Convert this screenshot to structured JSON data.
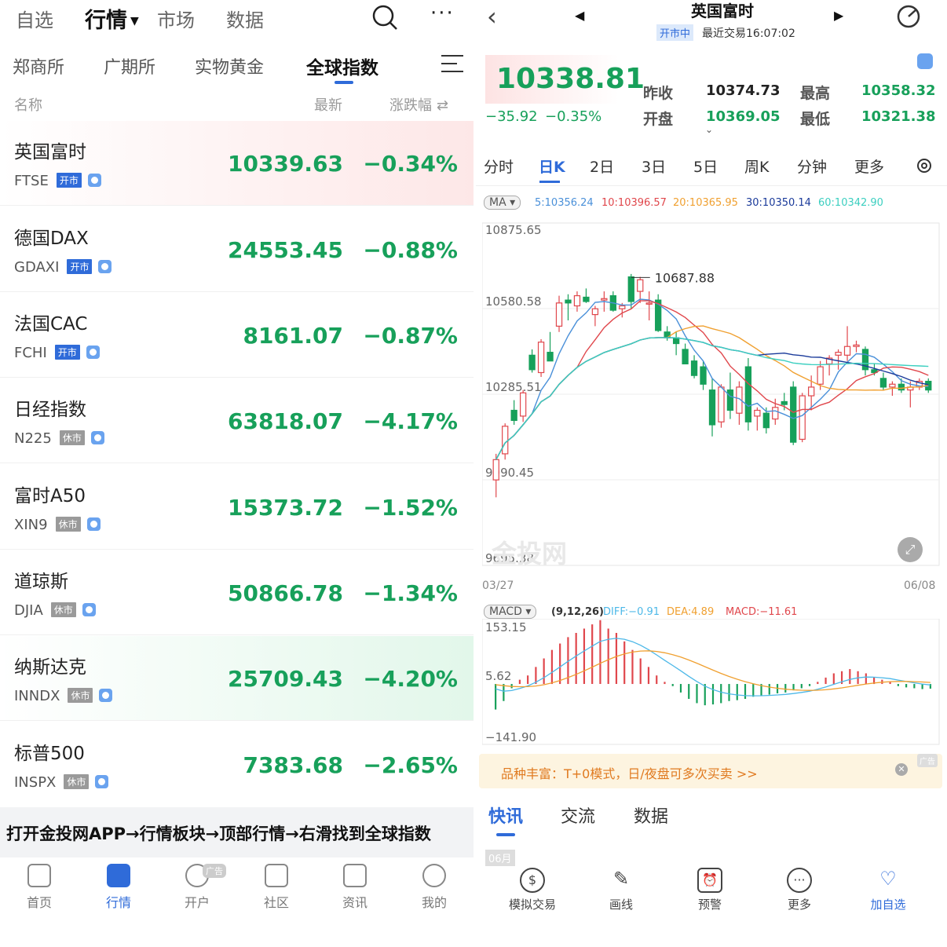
{
  "left": {
    "top_tabs": [
      "自选",
      "行情",
      "市场",
      "数据"
    ],
    "active_top_tab": "行情",
    "sub_tabs": [
      "郑商所",
      "广期所",
      "实物黄金",
      "全球指数"
    ],
    "active_sub_tab": "全球指数",
    "col_headers": {
      "name": "名称",
      "latest": "最新",
      "change": "涨跌幅"
    },
    "rows": [
      {
        "name": "英国富时",
        "code": "FTSE",
        "status": "开市",
        "price": "10339.63",
        "pct": "−0.34%",
        "highlight": "red"
      },
      {
        "name": "德国DAX",
        "code": "GDAXI",
        "status": "开市",
        "price": "24553.45",
        "pct": "−0.88%",
        "highlight": ""
      },
      {
        "name": "法国CAC",
        "code": "FCHI",
        "status": "开市",
        "price": "8161.07",
        "pct": "−0.87%",
        "highlight": ""
      },
      {
        "name": "日经指数",
        "code": "N225",
        "status": "休市",
        "price": "63818.07",
        "pct": "−4.17%",
        "highlight": ""
      },
      {
        "name": "富时A50",
        "code": "XIN9",
        "status": "休市",
        "price": "15373.72",
        "pct": "−1.52%",
        "highlight": ""
      },
      {
        "name": "道琼斯",
        "code": "DJIA",
        "status": "休市",
        "price": "50866.78",
        "pct": "−1.34%",
        "highlight": ""
      },
      {
        "name": "纳斯达克",
        "code": "INNDX",
        "status": "休市",
        "price": "25709.43",
        "pct": "−4.20%",
        "highlight": "green"
      },
      {
        "name": "标普500",
        "code": "INSPX",
        "status": "休市",
        "price": "7383.68",
        "pct": "−2.65%",
        "highlight": ""
      }
    ],
    "instruction": "打开金投网APP→行情板块→顶部行情→右滑找到全球指数",
    "bottom_nav": [
      "首页",
      "行情",
      "开户",
      "社区",
      "资讯",
      "我的"
    ],
    "active_nav": "行情",
    "ad_badge": "广告"
  },
  "right": {
    "title": "英国富时",
    "status_badge": "开市中",
    "last_trade": "最近交易16:07:02",
    "price": "10338.81",
    "change": "−35.92",
    "change_pct": "−0.35%",
    "stats": {
      "prev_close_label": "昨收",
      "prev_close": "10374.73",
      "open_label": "开盘",
      "open": "10369.05",
      "high_label": "最高",
      "high": "10358.32",
      "low_label": "最低",
      "low": "10321.38"
    },
    "periods": [
      "分时",
      "日K",
      "2日",
      "3日",
      "5日",
      "周K",
      "分钟",
      "更多"
    ],
    "active_period": "日K",
    "ma_label": "MA",
    "ma_values": [
      {
        "text": "5:10356.24",
        "color": "#4a90d9"
      },
      {
        "text": "10:10396.57",
        "color": "#e0474c"
      },
      {
        "text": "20:10365.95",
        "color": "#f0a030"
      },
      {
        "text": "30:10350.14",
        "color": "#1a3a9a"
      },
      {
        "text": "60:10342.90",
        "color": "#3ccfc0"
      }
    ],
    "price_axis": [
      "10875.65",
      "10580.58",
      "10285.51",
      "9990.45",
      "9695.38"
    ],
    "max_label": "10687.88",
    "date_start": "03/27",
    "date_end": "06/08",
    "watermark": "金投网",
    "macd_label": "MACD",
    "macd_params": "(9,12,26)",
    "macd_values": [
      {
        "text": "DIFF:−0.91",
        "color": "#4cb8e8"
      },
      {
        "text": "DEA:4.89",
        "color": "#f0a030"
      },
      {
        "text": "MACD:−11.61",
        "color": "#e0474c"
      }
    ],
    "macd_axis": [
      "153.15",
      "5.62",
      "−141.90"
    ],
    "banner_text": "品种丰富：T+0模式，日/夜盘可多次买卖 >>",
    "banner_ad": "广告",
    "news_tabs": [
      "快讯",
      "交流",
      "数据"
    ],
    "active_news_tab": "快讯",
    "month_label": "06月",
    "tools": [
      "模拟交易",
      "画线",
      "预警",
      "更多",
      "加自选"
    ]
  },
  "chart_data": [
    {
      "type": "candlestick",
      "title": "英国富时 日K",
      "x_range": [
        "03/27",
        "06/08"
      ],
      "ylim": [
        9695.38,
        10875.65
      ],
      "y_ticks": [
        10875.65,
        10580.58,
        10285.51,
        9990.45,
        9695.38
      ],
      "max_marker": 10687.88,
      "candles": [
        {
          "o": 9990,
          "h": 10080,
          "l": 9930,
          "c": 10060
        },
        {
          "o": 10080,
          "h": 10185,
          "l": 10060,
          "c": 10175
        },
        {
          "o": 10230,
          "h": 10265,
          "l": 10180,
          "c": 10195
        },
        {
          "o": 10210,
          "h": 10300,
          "l": 10190,
          "c": 10290
        },
        {
          "o": 10420,
          "h": 10440,
          "l": 10360,
          "c": 10370
        },
        {
          "o": 10360,
          "h": 10475,
          "l": 10345,
          "c": 10465
        },
        {
          "o": 10430,
          "h": 10500,
          "l": 10400,
          "c": 10400
        },
        {
          "o": 10520,
          "h": 10625,
          "l": 10500,
          "c": 10600
        },
        {
          "o": 10610,
          "h": 10630,
          "l": 10540,
          "c": 10600
        },
        {
          "o": 10590,
          "h": 10640,
          "l": 10570,
          "c": 10625
        },
        {
          "o": 10620,
          "h": 10650,
          "l": 10600,
          "c": 10605
        },
        {
          "o": 10560,
          "h": 10590,
          "l": 10520,
          "c": 10580
        },
        {
          "o": 10610,
          "h": 10640,
          "l": 10570,
          "c": 10615
        },
        {
          "o": 10625,
          "h": 10640,
          "l": 10570,
          "c": 10575
        },
        {
          "o": 10580,
          "h": 10600,
          "l": 10550,
          "c": 10590
        },
        {
          "o": 10690,
          "h": 10700,
          "l": 10580,
          "c": 10605
        },
        {
          "o": 10640,
          "h": 10690,
          "l": 10600,
          "c": 10680
        },
        {
          "o": 10600,
          "h": 10640,
          "l": 10540,
          "c": 10600
        },
        {
          "o": 10610,
          "h": 10630,
          "l": 10500,
          "c": 10505
        },
        {
          "o": 10500,
          "h": 10520,
          "l": 10470,
          "c": 10480
        },
        {
          "o": 10480,
          "h": 10500,
          "l": 10420,
          "c": 10460
        },
        {
          "o": 10440,
          "h": 10460,
          "l": 10390,
          "c": 10390
        },
        {
          "o": 10400,
          "h": 10420,
          "l": 10340,
          "c": 10350
        },
        {
          "o": 10380,
          "h": 10400,
          "l": 10300,
          "c": 10320
        },
        {
          "o": 10300,
          "h": 10340,
          "l": 10140,
          "c": 10180
        },
        {
          "o": 10190,
          "h": 10320,
          "l": 10170,
          "c": 10310
        },
        {
          "o": 10300,
          "h": 10360,
          "l": 10200,
          "c": 10230
        },
        {
          "o": 10220,
          "h": 10330,
          "l": 10180,
          "c": 10310
        },
        {
          "o": 10380,
          "h": 10410,
          "l": 10160,
          "c": 10190
        },
        {
          "o": 10210,
          "h": 10240,
          "l": 10160,
          "c": 10230
        },
        {
          "o": 10220,
          "h": 10240,
          "l": 10150,
          "c": 10170
        },
        {
          "o": 10200,
          "h": 10270,
          "l": 10180,
          "c": 10240
        },
        {
          "o": 10260,
          "h": 10290,
          "l": 10230,
          "c": 10250
        },
        {
          "o": 10310,
          "h": 10330,
          "l": 10110,
          "c": 10120
        },
        {
          "o": 10130,
          "h": 10290,
          "l": 10120,
          "c": 10280
        },
        {
          "o": 10280,
          "h": 10350,
          "l": 10230,
          "c": 10310
        },
        {
          "o": 10320,
          "h": 10400,
          "l": 10300,
          "c": 10380
        },
        {
          "o": 10390,
          "h": 10420,
          "l": 10350,
          "c": 10410
        },
        {
          "o": 10420,
          "h": 10440,
          "l": 10370,
          "c": 10430
        },
        {
          "o": 10420,
          "h": 10520,
          "l": 10400,
          "c": 10450
        },
        {
          "o": 10450,
          "h": 10470,
          "l": 10430,
          "c": 10455
        },
        {
          "o": 10440,
          "h": 10450,
          "l": 10350,
          "c": 10370
        },
        {
          "o": 10370,
          "h": 10390,
          "l": 10350,
          "c": 10360
        },
        {
          "o": 10340,
          "h": 10360,
          "l": 10300,
          "c": 10310
        },
        {
          "o": 10310,
          "h": 10330,
          "l": 10280,
          "c": 10320
        },
        {
          "o": 10320,
          "h": 10340,
          "l": 10290,
          "c": 10300
        },
        {
          "o": 10300,
          "h": 10330,
          "l": 10240,
          "c": 10310
        },
        {
          "o": 10310,
          "h": 10340,
          "l": 10300,
          "c": 10330
        },
        {
          "o": 10330,
          "h": 10340,
          "l": 10290,
          "c": 10300
        }
      ],
      "ma_lines": [
        {
          "name": "MA5",
          "color": "#4a90d9"
        },
        {
          "name": "MA10",
          "color": "#e0474c"
        },
        {
          "name": "MA20",
          "color": "#f0a030"
        },
        {
          "name": "MA30",
          "color": "#1a3a9a"
        },
        {
          "name": "MA60",
          "color": "#3ccfc0"
        }
      ]
    },
    {
      "type": "bar",
      "title": "MACD (9,12,26)",
      "ylim": [
        -141.9,
        153.15
      ],
      "y_ticks": [
        153.15,
        5.62,
        -141.9
      ],
      "values": [
        -60,
        -40,
        -10,
        10,
        20,
        40,
        60,
        80,
        95,
        110,
        120,
        130,
        140,
        150,
        130,
        120,
        100,
        80,
        60,
        40,
        20,
        5,
        -5,
        -20,
        -35,
        -45,
        -50,
        -48,
        -45,
        -40,
        -38,
        -35,
        -30,
        -28,
        -25,
        -22,
        -20,
        -15,
        -10,
        -5,
        5,
        15,
        25,
        30,
        35,
        30,
        25,
        15,
        10,
        5,
        -5,
        -8,
        -10,
        -12,
        -11
      ],
      "diff_color": "#4cb8e8",
      "dea_color": "#f0a030"
    }
  ]
}
